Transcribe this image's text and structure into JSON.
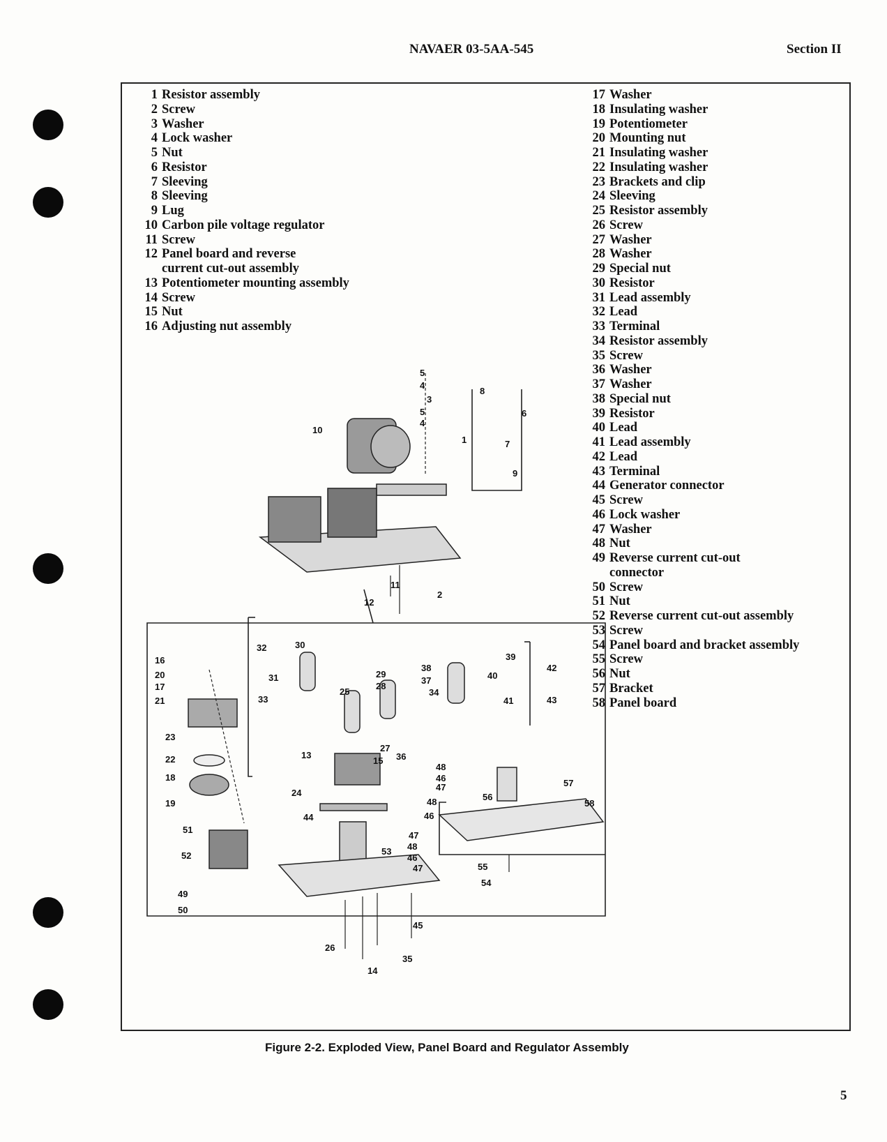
{
  "header": {
    "doc_number": "NAVAER 03-5AA-545",
    "section": "Section II"
  },
  "parts_left": [
    {
      "n": "1",
      "label": "Resistor assembly"
    },
    {
      "n": "2",
      "label": "Screw"
    },
    {
      "n": "3",
      "label": "Washer"
    },
    {
      "n": "4",
      "label": "Lock washer"
    },
    {
      "n": "5",
      "label": "Nut"
    },
    {
      "n": "6",
      "label": "Resistor"
    },
    {
      "n": "7",
      "label": "Sleeving"
    },
    {
      "n": "8",
      "label": "Sleeving"
    },
    {
      "n": "9",
      "label": "Lug"
    },
    {
      "n": "10",
      "label": "Carbon pile voltage regulator"
    },
    {
      "n": "11",
      "label": "Screw"
    },
    {
      "n": "12",
      "label": "Panel board and reverse",
      "cont": "current cut-out assembly"
    },
    {
      "n": "13",
      "label": "Potentiometer mounting assembly"
    },
    {
      "n": "14",
      "label": "Screw"
    },
    {
      "n": "15",
      "label": "Nut"
    },
    {
      "n": "16",
      "label": "Adjusting nut assembly"
    }
  ],
  "parts_right": [
    {
      "n": "17",
      "label": "Washer"
    },
    {
      "n": "18",
      "label": "Insulating washer"
    },
    {
      "n": "19",
      "label": "Potentiometer"
    },
    {
      "n": "20",
      "label": "Mounting nut"
    },
    {
      "n": "21",
      "label": "Insulating washer"
    },
    {
      "n": "22",
      "label": "Insulating washer"
    },
    {
      "n": "23",
      "label": "Brackets and clip"
    },
    {
      "n": "24",
      "label": "Sleeving"
    },
    {
      "n": "25",
      "label": "Resistor assembly"
    },
    {
      "n": "26",
      "label": "Screw"
    },
    {
      "n": "27",
      "label": "Washer"
    },
    {
      "n": "28",
      "label": "Washer"
    },
    {
      "n": "29",
      "label": "Special nut"
    },
    {
      "n": "30",
      "label": "Resistor"
    },
    {
      "n": "31",
      "label": "Lead assembly"
    },
    {
      "n": "32",
      "label": "Lead"
    },
    {
      "n": "33",
      "label": "Terminal"
    },
    {
      "n": "34",
      "label": "Resistor assembly"
    },
    {
      "n": "35",
      "label": "Screw"
    },
    {
      "n": "36",
      "label": "Washer"
    },
    {
      "n": "37",
      "label": "Washer"
    },
    {
      "n": "38",
      "label": "Special nut"
    },
    {
      "n": "39",
      "label": "Resistor"
    },
    {
      "n": "40",
      "label": "Lead"
    },
    {
      "n": "41",
      "label": "Lead assembly"
    },
    {
      "n": "42",
      "label": "Lead"
    },
    {
      "n": "43",
      "label": "Terminal"
    },
    {
      "n": "44",
      "label": "Generator connector"
    },
    {
      "n": "45",
      "label": "Screw"
    },
    {
      "n": "46",
      "label": "Lock washer"
    },
    {
      "n": "47",
      "label": "Washer"
    },
    {
      "n": "48",
      "label": "Nut"
    },
    {
      "n": "49",
      "label": "Reverse current cut-out",
      "cont": "connector"
    },
    {
      "n": "50",
      "label": "Screw"
    },
    {
      "n": "51",
      "label": "Nut"
    },
    {
      "n": "52",
      "label": "Reverse current cut-out assembly"
    },
    {
      "n": "53",
      "label": "Screw"
    },
    {
      "n": "54",
      "label": "Panel board and bracket assembly"
    },
    {
      "n": "55",
      "label": "Screw"
    },
    {
      "n": "56",
      "label": "Nut"
    },
    {
      "n": "57",
      "label": "Bracket"
    },
    {
      "n": "58",
      "label": "Panel board"
    }
  ],
  "figure": {
    "callouts": [
      "5",
      "4",
      "3",
      "5",
      "4",
      "8",
      "6",
      "1",
      "7",
      "9",
      "10",
      "11",
      "2",
      "12",
      "16",
      "20",
      "17",
      "21",
      "32",
      "30",
      "31",
      "33",
      "29",
      "28",
      "38",
      "37",
      "34",
      "39",
      "40",
      "41",
      "42",
      "43",
      "25",
      "27",
      "36",
      "15",
      "13",
      "48",
      "46",
      "47",
      "48",
      "46",
      "47",
      "48",
      "46",
      "47",
      "44",
      "24",
      "23",
      "22",
      "18",
      "19",
      "51",
      "52",
      "53",
      "49",
      "50",
      "56",
      "57",
      "58",
      "55",
      "54",
      "45",
      "26",
      "14",
      "35"
    ],
    "caption": "Figure 2-2.  Exploded View, Panel Board and Regulator Assembly"
  },
  "page_number": "5",
  "colors": {
    "ink": "#111111",
    "paper": "#fdfdfb"
  }
}
